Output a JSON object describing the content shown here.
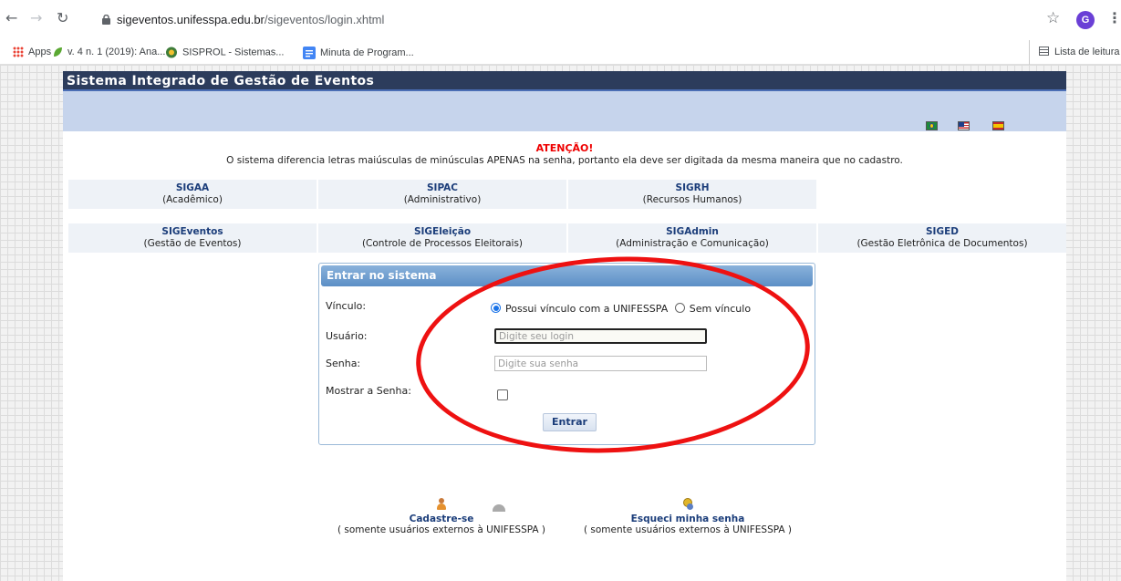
{
  "browser": {
    "url_host": "sigeventos.unifesspa.edu.br",
    "url_path": "/sigeventos/login.xhtml",
    "profile_initial": "G",
    "bookmarks": [
      {
        "label": "Apps",
        "icon": "apps-grid-icon"
      },
      {
        "label": "v. 4 n. 1 (2019): Ana...",
        "icon": "leaf-icon"
      },
      {
        "label": "SISPROL - Sistemas...",
        "icon": "coat-of-arms-icon"
      },
      {
        "label": "Minuta de Program...",
        "icon": "docs-icon"
      }
    ],
    "reading_list": "Lista de leitura"
  },
  "header": {
    "title": "Sistema Integrado de Gestão de Eventos",
    "languages": [
      "pt-BR",
      "en",
      "es"
    ]
  },
  "notice": {
    "heading": "ATENÇÃO!",
    "message": "O sistema diferencia letras maiúsculas de minúsculas APENAS na senha, portanto ela deve ser digitada da mesma maneira que no cadastro."
  },
  "systems_row1": [
    {
      "name": "SIGAA",
      "desc": "(Acadêmico)"
    },
    {
      "name": "SIPAC",
      "desc": "(Administrativo)"
    },
    {
      "name": "SIGRH",
      "desc": "(Recursos Humanos)"
    }
  ],
  "systems_row2": [
    {
      "name": "SIGEventos",
      "desc": "(Gestão de Eventos)"
    },
    {
      "name": "SIGEleição",
      "desc": "(Controle de Processos Eleitorais)"
    },
    {
      "name": "SIGAdmin",
      "desc": "(Administração e Comunicação)"
    },
    {
      "name": "SIGED",
      "desc": "(Gestão Eletrônica de Documentos)"
    }
  ],
  "login": {
    "heading": "Entrar no sistema",
    "vinculo_label": "Vínculo:",
    "vinculo_option1": "Possui vínculo com a UNIFESSPA",
    "vinculo_option2": "Sem vínculo",
    "vinculo_selected": "Possui vínculo com a UNIFESSPA",
    "user_label": "Usuário:",
    "user_placeholder": "Digite seu login",
    "user_value": "",
    "password_label": "Senha:",
    "password_placeholder": "Digite sua senha",
    "password_value": "",
    "show_password_label": "Mostrar a Senha:",
    "show_password_checked": false,
    "submit_label": "Entrar"
  },
  "links": {
    "register_label": "Cadastre-se",
    "register_desc": "( somente usuários externos à UNIFESSPA )",
    "forgot_label": "Esqueci minha senha",
    "forgot_desc": "( somente usuários externos à UNIFESSPA )"
  },
  "colors": {
    "title_bar": "#2c3c5c",
    "band": "#c6d4ec",
    "annotation_ellipse": "#ee1111",
    "notice_heading": "#ee0000"
  }
}
